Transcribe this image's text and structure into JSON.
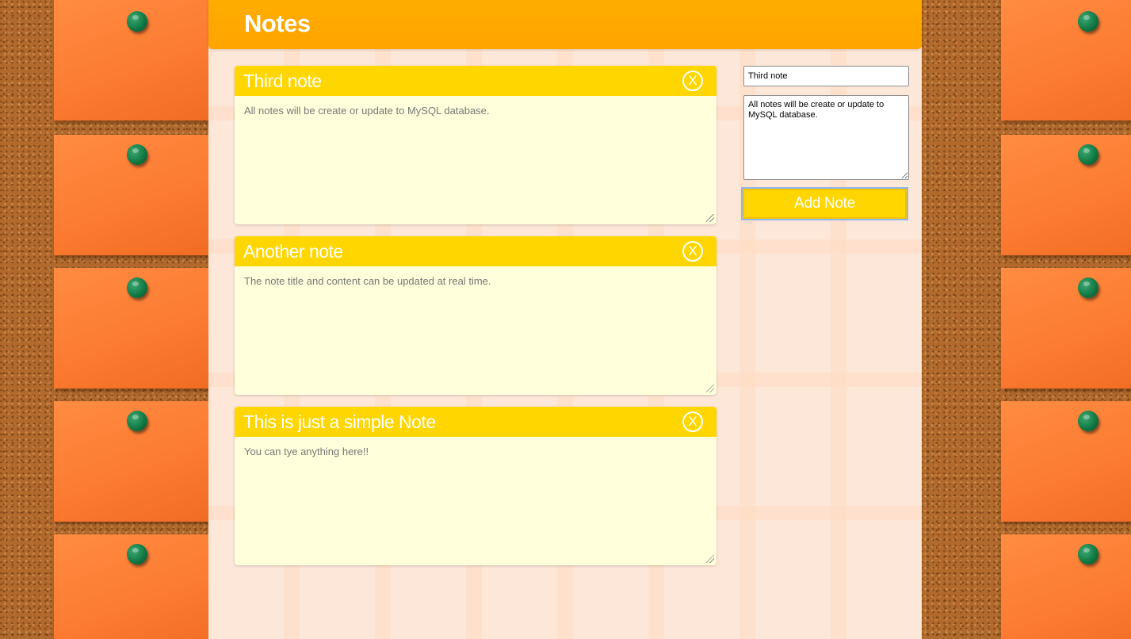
{
  "header": {
    "title": "Notes"
  },
  "notes": [
    {
      "title": "Third note",
      "content": "All notes will be create or update to MySQL database.",
      "close_label": "X"
    },
    {
      "title": "Another note",
      "content": "The note title and content can be updated at real time.",
      "close_label": "X"
    },
    {
      "title": "This is just a simple Note",
      "content": "You can tye anything here!!",
      "close_label": "X"
    }
  ],
  "form": {
    "title_value": "Third note",
    "content_value": "All notes will be create or update to MySQL database.",
    "add_label": "Add Note"
  },
  "colors": {
    "header": "#ffa400",
    "note_header": "#ffd600",
    "note_body": "#ffffdc",
    "sticky": "#fb7a30",
    "pin": "#117a45"
  }
}
